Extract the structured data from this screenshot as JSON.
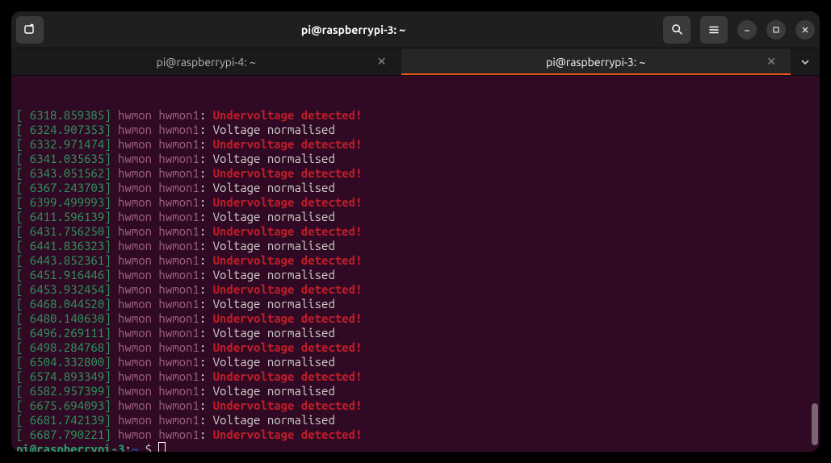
{
  "window": {
    "title": "pi@raspberrypi-3: ~"
  },
  "tabs": [
    {
      "label": "pi@raspberrypi-4: ~",
      "active": false
    },
    {
      "label": "pi@raspberrypi-3: ~",
      "active": true
    }
  ],
  "log_lines": [
    {
      "ts": "6318.859385",
      "kw": "hwmon hwmon1",
      "msg": "Undervoltage detected!",
      "err": true
    },
    {
      "ts": "6324.907353",
      "kw": "hwmon hwmon1",
      "msg": "Voltage normalised",
      "err": false
    },
    {
      "ts": "6332.971474",
      "kw": "hwmon hwmon1",
      "msg": "Undervoltage detected!",
      "err": true
    },
    {
      "ts": "6341.035635",
      "kw": "hwmon hwmon1",
      "msg": "Voltage normalised",
      "err": false
    },
    {
      "ts": "6343.051562",
      "kw": "hwmon hwmon1",
      "msg": "Undervoltage detected!",
      "err": true
    },
    {
      "ts": "6367.243703",
      "kw": "hwmon hwmon1",
      "msg": "Voltage normalised",
      "err": false
    },
    {
      "ts": "6399.499993",
      "kw": "hwmon hwmon1",
      "msg": "Undervoltage detected!",
      "err": true
    },
    {
      "ts": "6411.596139",
      "kw": "hwmon hwmon1",
      "msg": "Voltage normalised",
      "err": false
    },
    {
      "ts": "6431.756250",
      "kw": "hwmon hwmon1",
      "msg": "Undervoltage detected!",
      "err": true
    },
    {
      "ts": "6441.836323",
      "kw": "hwmon hwmon1",
      "msg": "Voltage normalised",
      "err": false
    },
    {
      "ts": "6443.852361",
      "kw": "hwmon hwmon1",
      "msg": "Undervoltage detected!",
      "err": true
    },
    {
      "ts": "6451.916446",
      "kw": "hwmon hwmon1",
      "msg": "Voltage normalised",
      "err": false
    },
    {
      "ts": "6453.932454",
      "kw": "hwmon hwmon1",
      "msg": "Undervoltage detected!",
      "err": true
    },
    {
      "ts": "6468.044520",
      "kw": "hwmon hwmon1",
      "msg": "Voltage normalised",
      "err": false
    },
    {
      "ts": "6480.140630",
      "kw": "hwmon hwmon1",
      "msg": "Undervoltage detected!",
      "err": true
    },
    {
      "ts": "6496.269111",
      "kw": "hwmon hwmon1",
      "msg": "Voltage normalised",
      "err": false
    },
    {
      "ts": "6498.284768",
      "kw": "hwmon hwmon1",
      "msg": "Undervoltage detected!",
      "err": true
    },
    {
      "ts": "6504.332800",
      "kw": "hwmon hwmon1",
      "msg": "Voltage normalised",
      "err": false
    },
    {
      "ts": "6574.893349",
      "kw": "hwmon hwmon1",
      "msg": "Undervoltage detected!",
      "err": true
    },
    {
      "ts": "6582.957399",
      "kw": "hwmon hwmon1",
      "msg": "Voltage normalised",
      "err": false
    },
    {
      "ts": "6675.694093",
      "kw": "hwmon hwmon1",
      "msg": "Undervoltage detected!",
      "err": true
    },
    {
      "ts": "6681.742139",
      "kw": "hwmon hwmon1",
      "msg": "Voltage normalised",
      "err": false
    },
    {
      "ts": "6687.790221",
      "kw": "hwmon hwmon1",
      "msg": "Undervoltage detected!",
      "err": true
    }
  ],
  "prompt": {
    "host": "pi@raspberrypi-3",
    "path": "~",
    "symbol": "$"
  }
}
